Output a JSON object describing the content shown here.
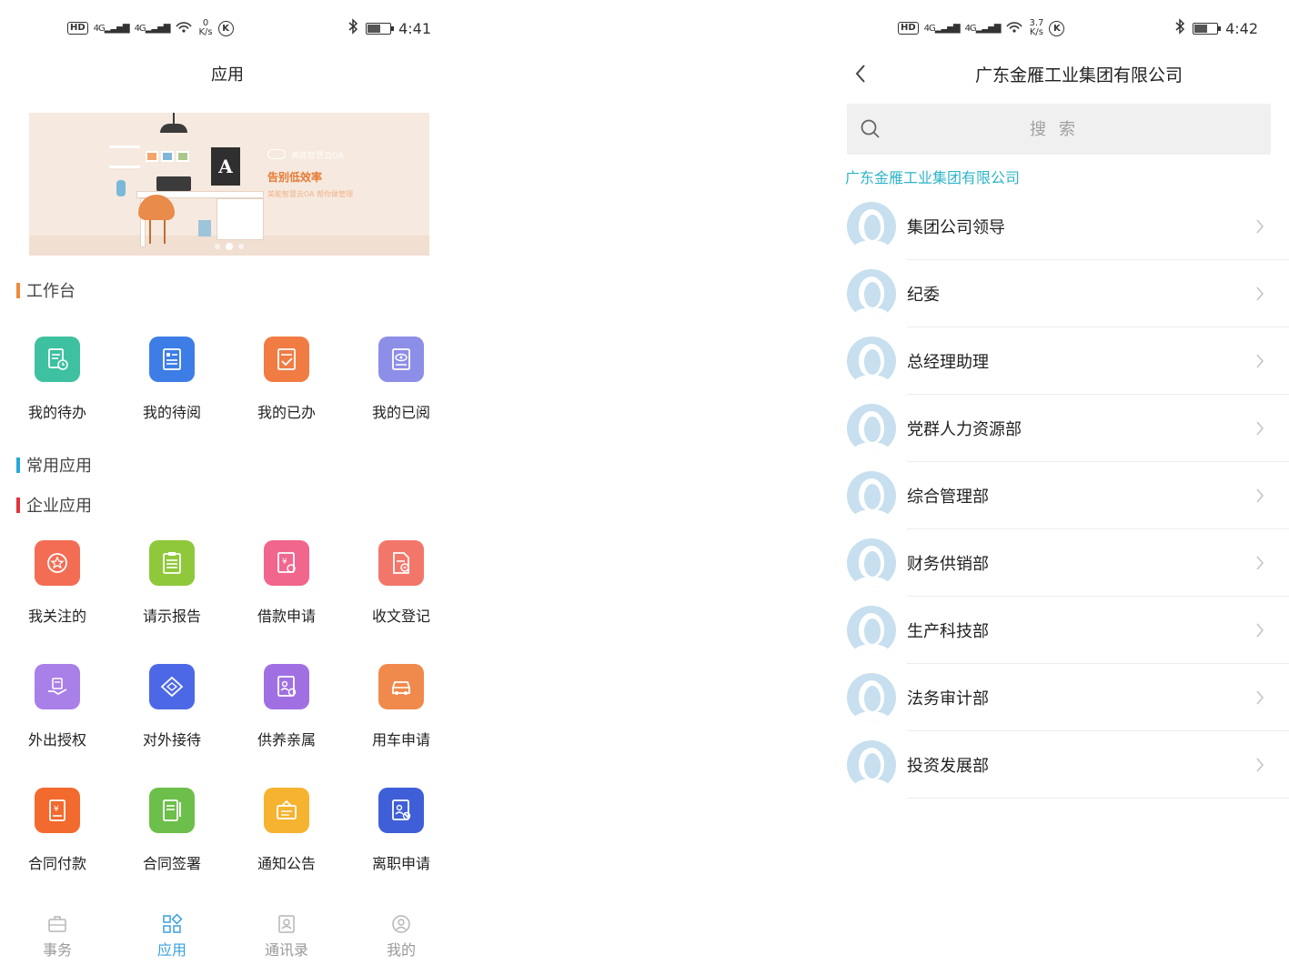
{
  "left": {
    "status": {
      "speed_value": "0",
      "speed_unit": "K/s",
      "time": "4:41"
    },
    "title": "应用",
    "banner": {
      "poster_letter": "A",
      "brand": "美能智慧云OA",
      "slogan": "告别低效率",
      "subslogan": "美能智慧云OA 帮你做管理"
    },
    "sections": {
      "workbench": {
        "label": "工作台",
        "color": "#ef8a3a"
      },
      "common": {
        "label": "常用应用",
        "color": "#28a8d8"
      },
      "enterprise": {
        "label": "企业应用",
        "color": "#e0343c"
      }
    },
    "workbench_apps": [
      {
        "label": "我的待办",
        "color": "#3ec1a0"
      },
      {
        "label": "我的待阅",
        "color": "#3d7ee6"
      },
      {
        "label": "我的已办",
        "color": "#f07c43"
      },
      {
        "label": "我的已阅",
        "color": "#8c8ee8"
      }
    ],
    "enterprise_apps": [
      {
        "label": "我关注的",
        "color": "#f36d55"
      },
      {
        "label": "请示报告",
        "color": "#8fc83a"
      },
      {
        "label": "借款申请",
        "color": "#f0668c"
      },
      {
        "label": "收文登记",
        "color": "#f2776a"
      },
      {
        "label": "外出授权",
        "color": "#a97fe8"
      },
      {
        "label": "对外接待",
        "color": "#4d68e6"
      },
      {
        "label": "供养亲属",
        "color": "#a070e3"
      },
      {
        "label": "用车申请",
        "color": "#f08a4c"
      },
      {
        "label": "合同付款",
        "color": "#f26a2e"
      },
      {
        "label": "合同签署",
        "color": "#6cbf4a"
      },
      {
        "label": "通知公告",
        "color": "#f6b32f"
      },
      {
        "label": "离职申请",
        "color": "#3f5fd8"
      }
    ],
    "tabs": [
      {
        "label": "事务",
        "active": false
      },
      {
        "label": "应用",
        "active": true
      },
      {
        "label": "通讯录",
        "active": false
      },
      {
        "label": "我的",
        "active": false
      }
    ]
  },
  "right": {
    "status": {
      "speed_value": "3.7",
      "speed_unit": "K/s",
      "time": "4:42"
    },
    "title": "广东金雁工业集团有限公司",
    "search": {
      "placeholder": "搜索"
    },
    "breadcrumb": "广东金雁工业集团有限公司",
    "departments": [
      "集团公司领导",
      "纪委",
      "总经理助理",
      "党群人力资源部",
      "综合管理部",
      "财务供销部",
      "生产科技部",
      "法务审计部",
      "投资发展部"
    ]
  },
  "status_common": {
    "hd": "HD",
    "sig1": "4G",
    "sig2": "4G",
    "wifi_num": "1",
    "k": "K"
  }
}
